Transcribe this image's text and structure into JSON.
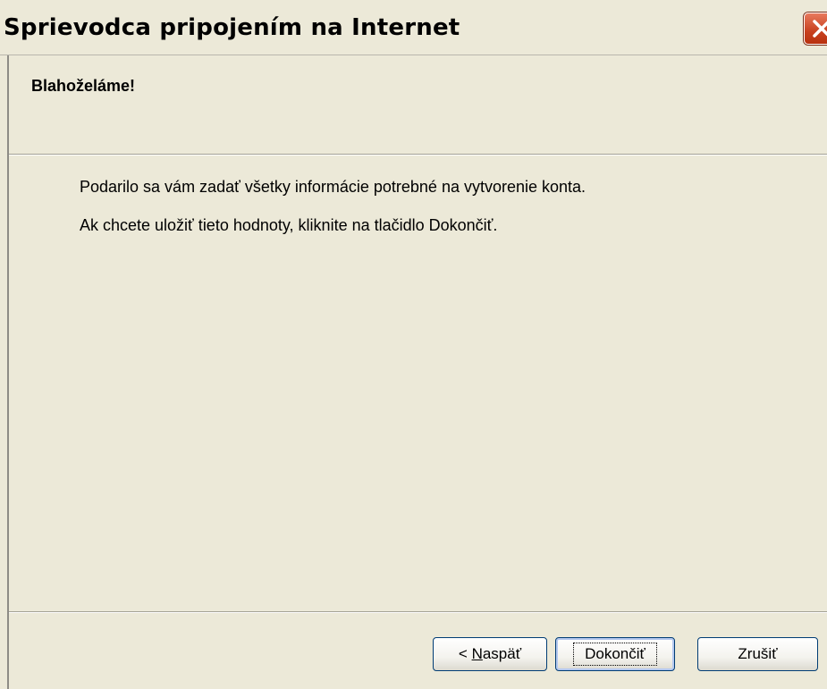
{
  "window": {
    "title": "Sprievodca pripojením na Internet",
    "close_icon": "close-icon",
    "accent_color": "#c8401f"
  },
  "header": {
    "title": "Blahoželáme!"
  },
  "content": {
    "line1": "Podarilo sa vám zadať všetky informácie potrebné na vytvorenie konta.",
    "line2": "Ak chcete uložiť tieto hodnoty, kliknite na tlačidlo Dokončiť."
  },
  "buttons": {
    "back_prefix": "< ",
    "back_access_key": "N",
    "back_rest": "aspäť",
    "finish": "Dokončiť",
    "cancel": "Zrušiť"
  }
}
